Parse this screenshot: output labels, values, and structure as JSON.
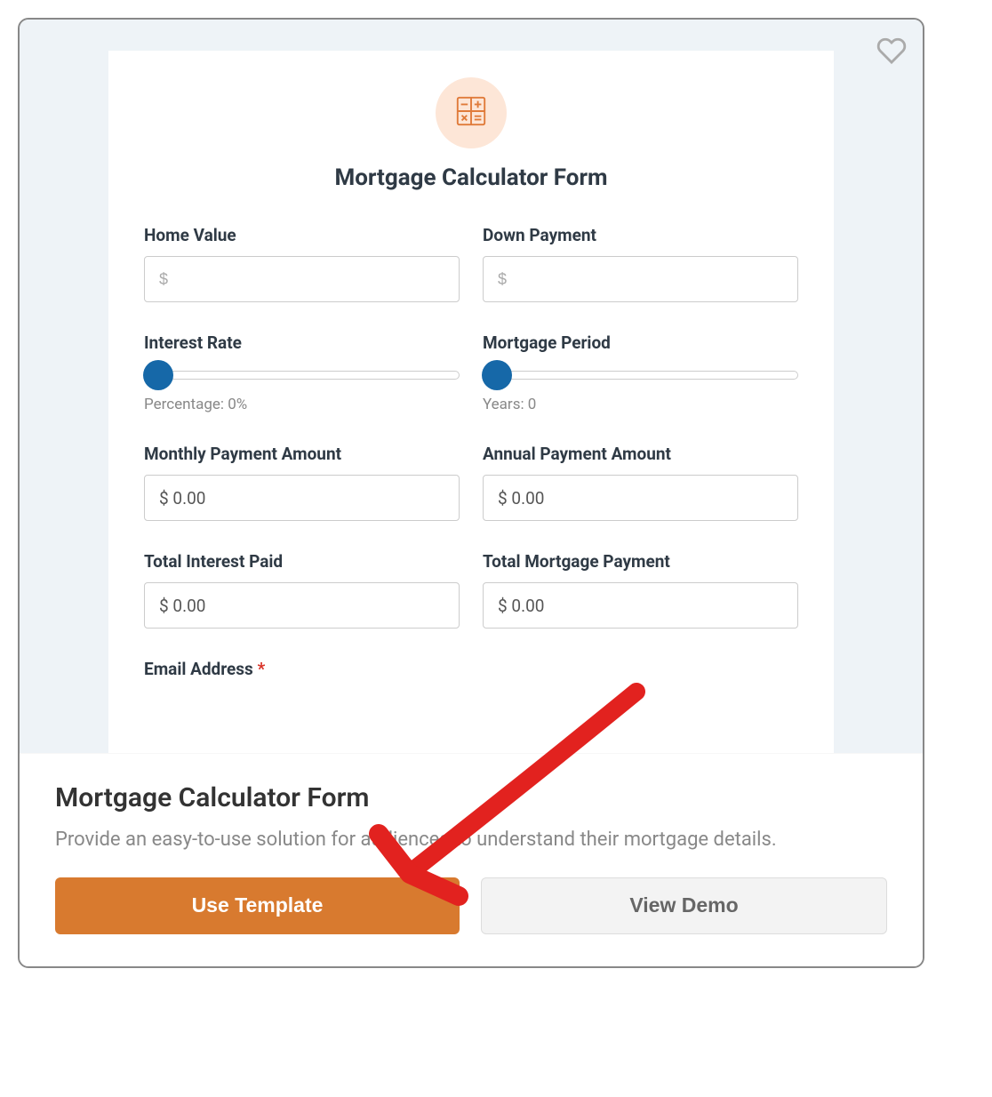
{
  "preview": {
    "title": "Mortgage Calculator Form",
    "fields": {
      "home_value": {
        "label": "Home Value",
        "placeholder": "$"
      },
      "down_payment": {
        "label": "Down Payment",
        "placeholder": "$"
      },
      "interest_rate": {
        "label": "Interest Rate",
        "caption": "Percentage: 0%"
      },
      "mortgage_period": {
        "label": "Mortgage Period",
        "caption": "Years: 0"
      },
      "monthly_payment": {
        "label": "Monthly Payment Amount",
        "value": "$ 0.00"
      },
      "annual_payment": {
        "label": "Annual Payment Amount",
        "value": "$ 0.00"
      },
      "total_interest": {
        "label": "Total Interest Paid",
        "value": "$ 0.00"
      },
      "total_mortgage": {
        "label": "Total Mortgage Payment",
        "value": "$ 0.00"
      },
      "email": {
        "label": "Email Address",
        "required_mark": "*"
      }
    }
  },
  "template": {
    "title": "Mortgage Calculator Form",
    "description": "Provide an easy-to-use solution for audiences to understand their mortgage details.",
    "use_button": "Use Template",
    "demo_button": "View Demo"
  }
}
